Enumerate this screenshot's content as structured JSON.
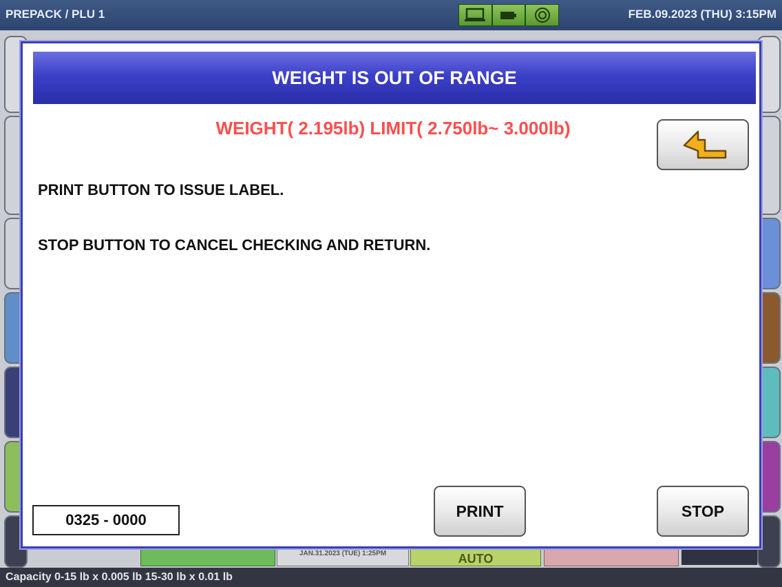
{
  "topbar": {
    "mode": "PREPACK / PLU 1",
    "datetime": "FEB.09.2023 (THU)   3:15PM",
    "icons": [
      "monitor-icon",
      "battery-icon",
      "network-icon"
    ]
  },
  "background": {
    "print_datetime": "JAN.31.2023 (TUE)   1:25PM",
    "auto_label": "AUTO"
  },
  "footer": {
    "capacity": "Capacity 0-15 lb x 0.005 lb  15-30 lb x 0.01 lb"
  },
  "dialog": {
    "title": "WEIGHT IS OUT OF RANGE",
    "weight_line": "WEIGHT(  2.195lb) LIMIT(  2.750lb~  3.000lb)",
    "message_print": "PRINT BUTTON TO ISSUE LABEL.",
    "message_stop": "STOP BUTTON TO CANCEL CHECKING AND RETURN.",
    "code": "0325 - 0000",
    "print_label": "PRINT",
    "stop_label": "STOP",
    "back_icon": "return-arrow-icon",
    "colors": {
      "title_bg": "#3c40c8",
      "warning_text": "#ff4d4d",
      "arrow": "#f2b01e"
    }
  }
}
